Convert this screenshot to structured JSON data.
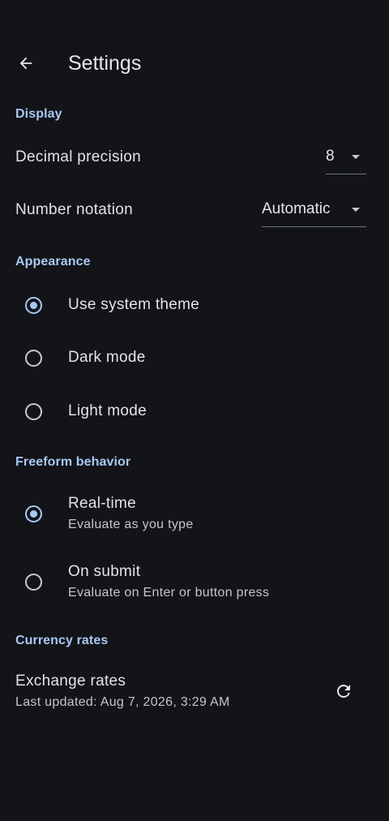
{
  "header": {
    "title": "Settings",
    "back_icon": "arrow-back-icon"
  },
  "display": {
    "section_title": "Display",
    "decimal_precision": {
      "label": "Decimal precision",
      "value": "8"
    },
    "number_notation": {
      "label": "Number notation",
      "value": "Automatic"
    }
  },
  "appearance": {
    "section_title": "Appearance",
    "options": [
      {
        "label": "Use system theme",
        "selected": true
      },
      {
        "label": "Dark mode",
        "selected": false
      },
      {
        "label": "Light mode",
        "selected": false
      }
    ]
  },
  "freeform": {
    "section_title": "Freeform behavior",
    "options": [
      {
        "label": "Real-time",
        "description": "Evaluate as you type",
        "selected": true
      },
      {
        "label": "On submit",
        "description": "Evaluate on Enter or button press",
        "selected": false
      }
    ]
  },
  "currency": {
    "section_title": "Currency rates",
    "exchange_label": "Exchange rates",
    "last_updated": "Last updated: Aug 7, 2026, 3:29 AM",
    "refresh_icon": "refresh-icon"
  },
  "colors": {
    "background": "#121418",
    "accent": "#a8c8f4",
    "text_primary": "#e3e3e8",
    "text_secondary": "#c4c6cb"
  }
}
